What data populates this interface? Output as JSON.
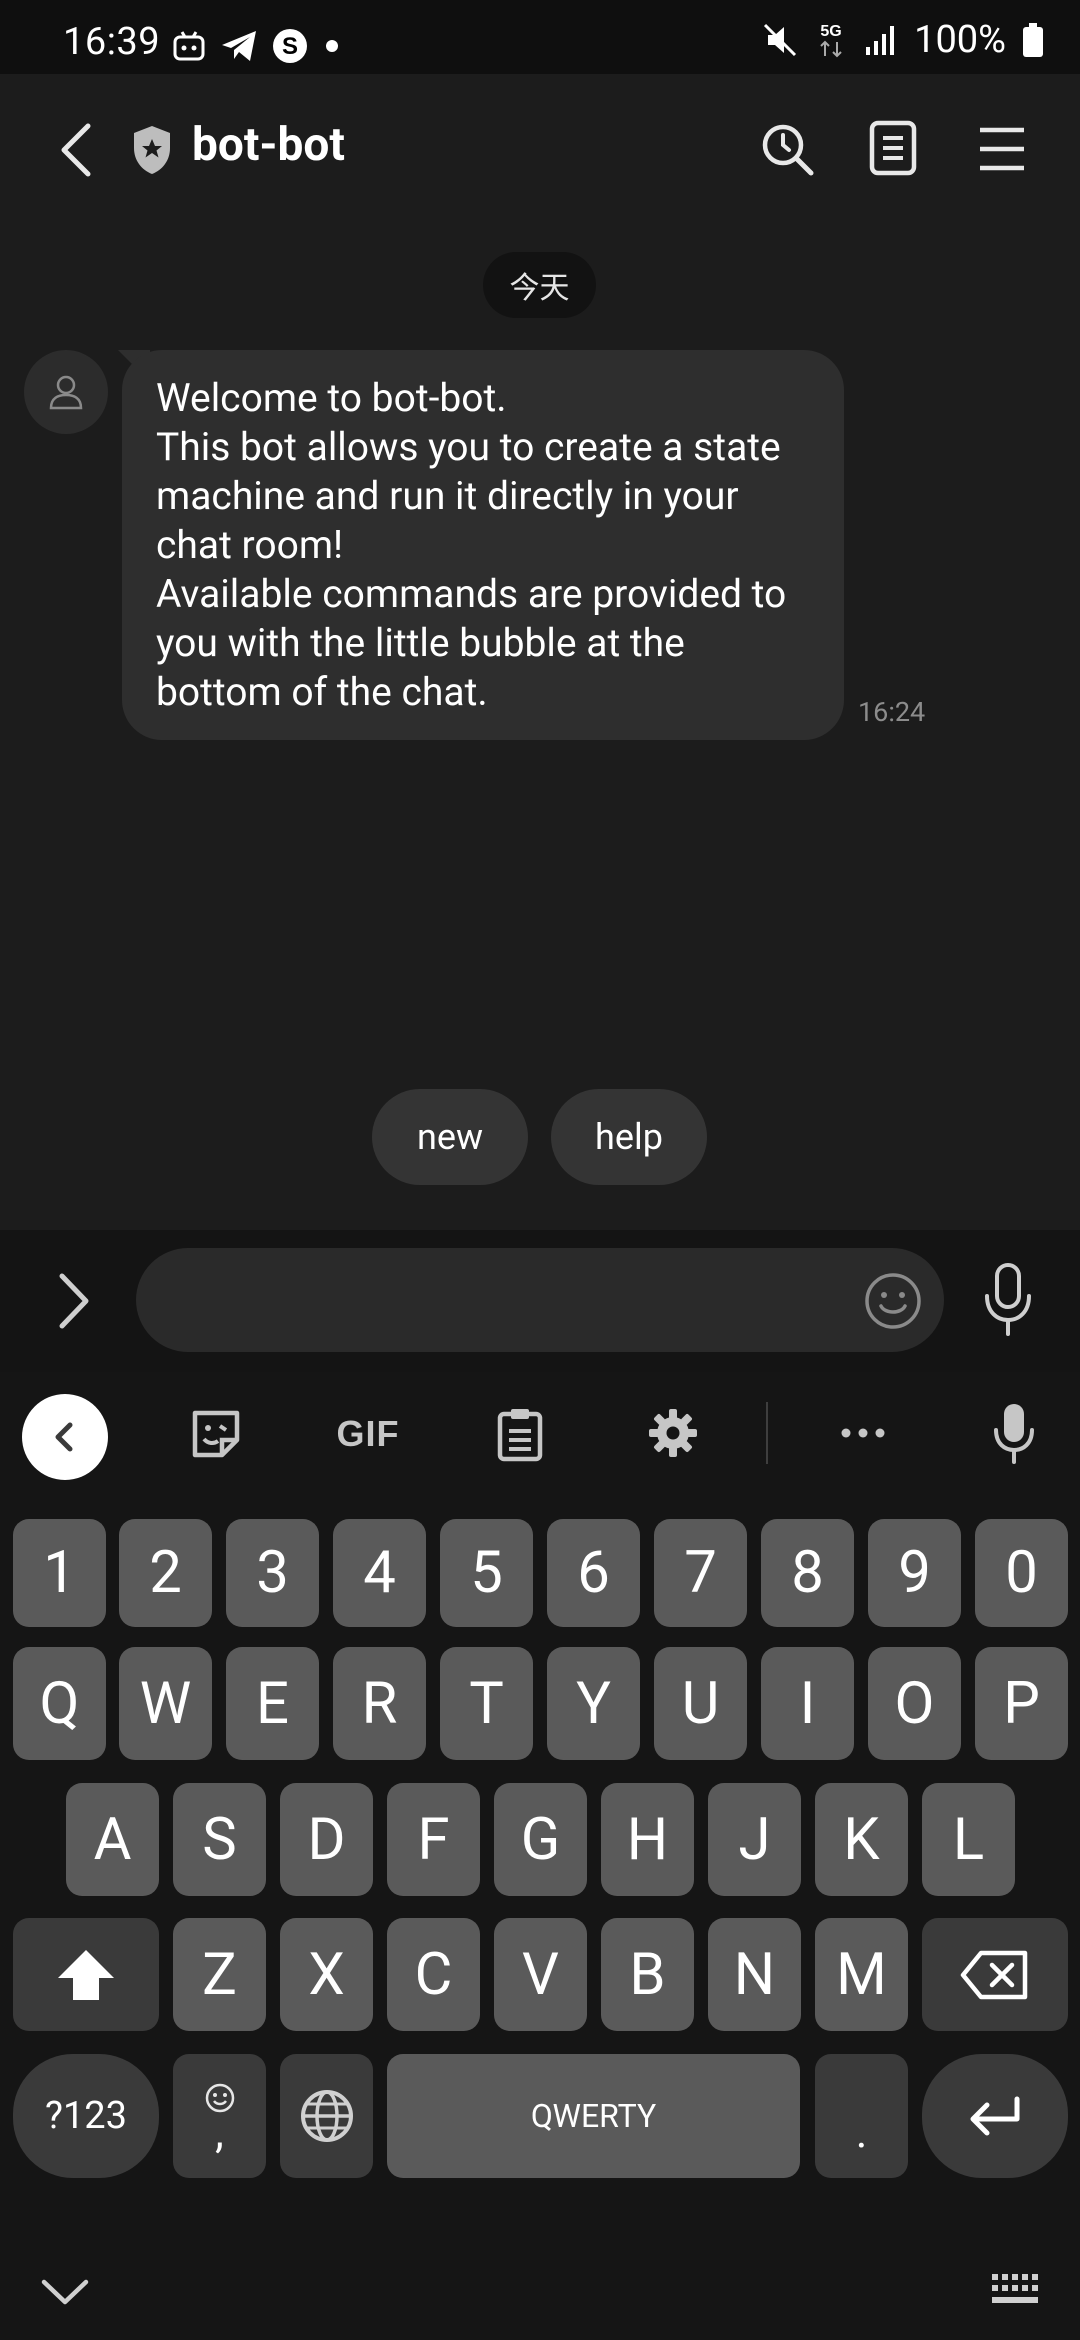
{
  "status_bar": {
    "time": "16:39",
    "battery": "100%",
    "network": "5G",
    "icons_left": [
      "app-icon",
      "telegram-icon",
      "s-icon",
      "dot-icon"
    ],
    "icons_right": [
      "mute-icon",
      "network-icon",
      "signal-icon",
      "battery-icon"
    ]
  },
  "header": {
    "title": "bot-bot",
    "icons": [
      "back-icon",
      "shield-icon",
      "search-icon",
      "notes-icon",
      "menu-icon"
    ]
  },
  "chat": {
    "date_label": "今天",
    "messages": [
      {
        "sender": "bot",
        "text": "Welcome to bot-bot.\nThis bot allows you to create a state machine and run it directly in your chat room!\nAvailable commands are provided to you with the little bubble at the bottom of the chat.",
        "time": "16:24"
      }
    ],
    "quick_replies": [
      "new",
      "help"
    ]
  },
  "input": {
    "value": "",
    "placeholder": ""
  },
  "keyboard": {
    "toolbar": {
      "gif_label": "GIF",
      "items": [
        "collapse-icon",
        "sticker-icon",
        "gif",
        "clipboard-icon",
        "settings-icon",
        "more-icon",
        "mic-icon"
      ]
    },
    "rows": {
      "numbers": [
        "1",
        "2",
        "3",
        "4",
        "5",
        "6",
        "7",
        "8",
        "9",
        "0"
      ],
      "row1": [
        "Q",
        "W",
        "E",
        "R",
        "T",
        "Y",
        "U",
        "I",
        "O",
        "P"
      ],
      "row2": [
        "A",
        "S",
        "D",
        "F",
        "G",
        "H",
        "J",
        "K",
        "L"
      ],
      "row3": [
        "Z",
        "X",
        "C",
        "V",
        "B",
        "N",
        "M"
      ]
    },
    "bottom": {
      "symbols_label": "?123",
      "comma": ",",
      "space_label": "QWERTY",
      "period": "."
    }
  },
  "colors": {
    "background": "#1c1c1c",
    "bubble": "#2e2e2e",
    "key": "#5a5a5a",
    "key_dark": "#3a3a3a"
  }
}
